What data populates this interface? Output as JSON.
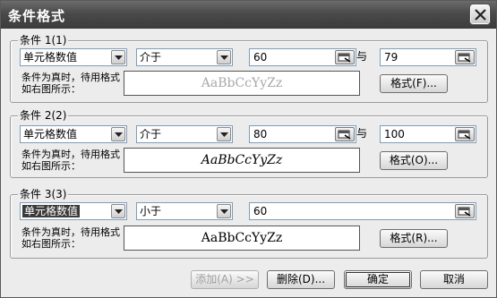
{
  "dialog": {
    "title": "条件格式"
  },
  "conditions": [
    {
      "label": "条件 1(1)",
      "type": "单元格数值",
      "operator": "介于",
      "value1": "60",
      "with_label": "与",
      "value2": "79",
      "description": "条件为真时，待用格式如右图所示：",
      "preview": "AaBbCcYyZz",
      "format_button": "格式(F)..."
    },
    {
      "label": "条件 2(2)",
      "type": "单元格数值",
      "operator": "介于",
      "value1": "80",
      "with_label": "与",
      "value2": "100",
      "description": "条件为真时，待用格式如右图所示：",
      "preview": "AaBbCcYyZz",
      "format_button": "格式(O)..."
    },
    {
      "label": "条件 3(3)",
      "type": "单元格数值",
      "operator": "小于",
      "value1": "60",
      "description": "条件为真时，待用格式如右图所示：",
      "preview": "AaBbCcYyZz",
      "format_button": "格式(R)..."
    }
  ],
  "buttons": {
    "add": "添加(A) >>",
    "delete": "删除(D)...",
    "ok": "确定",
    "cancel": "取消"
  }
}
